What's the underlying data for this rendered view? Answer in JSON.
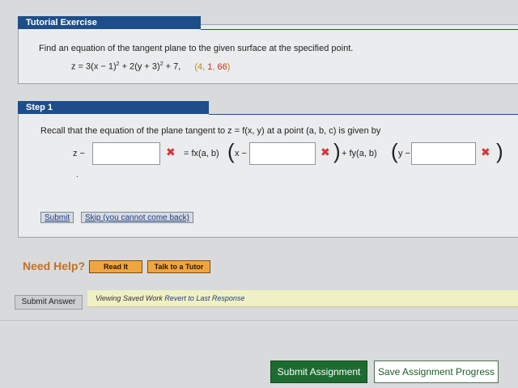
{
  "exercise": {
    "tab_label": "Tutorial Exercise",
    "prompt": "Find an equation of the tangent plane to the given surface at the specified point.",
    "eq_z": "z = 3(x − 1)",
    "eq_sup1": "2",
    "eq_mid": " + 2(y + 3)",
    "eq_sup2": "2",
    "eq_end": " + 7,",
    "pt_open": "(4, ",
    "pt_y": "1",
    "pt_sep": ", ",
    "pt_z": "66",
    "pt_close": ")"
  },
  "step": {
    "tab_label": "Step 1",
    "recall": "Recall that the equation of the plane tangent to z = f(x, y) at a point (a, b, c) is given by",
    "z_minus": "z −",
    "mid1": "= fx(a, b)",
    "x_minus": "x −",
    "plus_fy": "+ fy(a, b)",
    "y_minus": "y −",
    "x_icon": "✖",
    "paren_open": "(",
    "paren_close": ")",
    "dot": ".",
    "inputs": [
      "",
      "",
      ""
    ]
  },
  "buttons": {
    "submit": "Submit",
    "skip": "Skip (you cannot come back)",
    "read_it": "Read It",
    "talk": "Talk to a Tutor",
    "submit_answer": "Submit Answer",
    "submit_assignment": "Submit Assignment",
    "save_progress": "Save Assignment Progress"
  },
  "help": {
    "label": "Need Help?"
  },
  "saved": {
    "text": "Viewing Saved Work ",
    "link": "Revert to Last Response"
  },
  "colors": {
    "header": "#1d4e89",
    "incorrect": "#d8333b",
    "point_highlight": "#cc2a1c",
    "submit_green": "#1e6b32",
    "help_orange": "#f0a640"
  }
}
